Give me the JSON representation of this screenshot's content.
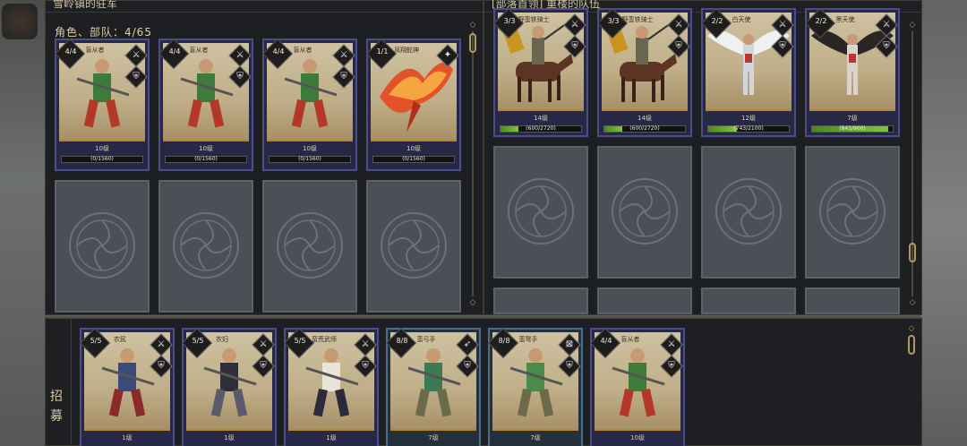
{
  "left_panel": {
    "title": "雪岭镇的驻军",
    "count_label": "角色、部队：4/65",
    "cards": [
      {
        "count": "4/4",
        "name": "盲从者",
        "level": "10级",
        "xp": "(0/1560)",
        "progress": 0,
        "icon1": "⚔",
        "icon2": "⛨",
        "art": "warrior"
      },
      {
        "count": "4/4",
        "name": "盲从者",
        "level": "10级",
        "xp": "(0/1560)",
        "progress": 0,
        "icon1": "⚔",
        "icon2": "⛨",
        "art": "warrior"
      },
      {
        "count": "4/4",
        "name": "盲从者",
        "level": "10级",
        "xp": "(0/1560)",
        "progress": 0,
        "icon1": "⚔",
        "icon2": "⛨",
        "art": "warrior"
      },
      {
        "count": "1/1",
        "name": "凤翔蛇神",
        "level": "10级",
        "xp": "(0/1560)",
        "progress": 0,
        "icon1": "✦",
        "icon2": "",
        "art": "phoenix"
      }
    ]
  },
  "right_panel": {
    "title": "[部落首领] 重楼的队伍",
    "cards": [
      {
        "count": "3/3",
        "name": "野蛮铁骑士",
        "level": "14级",
        "xp": "(600/2720)",
        "progress": 0.22,
        "icon1": "⚔",
        "icon2": "⛨",
        "art": "rider"
      },
      {
        "count": "3/3",
        "name": "野蛮铁骑士",
        "level": "14级",
        "xp": "(600/2720)",
        "progress": 0.22,
        "icon1": "⚔",
        "icon2": "⛨",
        "art": "rider"
      },
      {
        "count": "2/2",
        "name": "白天使",
        "level": "12级",
        "xp": "(743/2100)",
        "progress": 0.35,
        "icon1": "⚔",
        "icon2": "⛨",
        "art": "angel_white"
      },
      {
        "count": "2/2",
        "name": "黑天使",
        "level": "7级",
        "xp": "(843/900)",
        "progress": 0.94,
        "icon1": "⚔",
        "icon2": "⛨",
        "art": "angel_black"
      }
    ]
  },
  "recruit_panel": {
    "label": "招募",
    "cards": [
      {
        "count": "5/5",
        "name": "农民",
        "level": "1级",
        "icon1": "⚔",
        "icon2": "⛨",
        "art": "farmer"
      },
      {
        "count": "5/5",
        "name": "农妇",
        "level": "1级",
        "icon1": "⚔",
        "icon2": "⛨",
        "art": "farmwife"
      },
      {
        "count": "5/5",
        "name": "蛮荒武师",
        "level": "1级",
        "icon1": "⚔",
        "icon2": "⛨",
        "art": "monk"
      },
      {
        "count": "8/8",
        "name": "蛮弓手",
        "level": "7级",
        "icon1": "➶",
        "icon2": "⛨",
        "art": "archer"
      },
      {
        "count": "8/8",
        "name": "蛮弩手",
        "level": "7级",
        "icon1": "⊠",
        "icon2": "⛨",
        "art": "archer2"
      },
      {
        "count": "4/4",
        "name": "盲从者",
        "level": "10级",
        "icon1": "⚔",
        "icon2": "⛨",
        "art": "warrior"
      }
    ]
  },
  "colors": {
    "card_border": "#4c4e8a",
    "progress_fill": "#7ec73a",
    "gold": "#b6862e"
  }
}
